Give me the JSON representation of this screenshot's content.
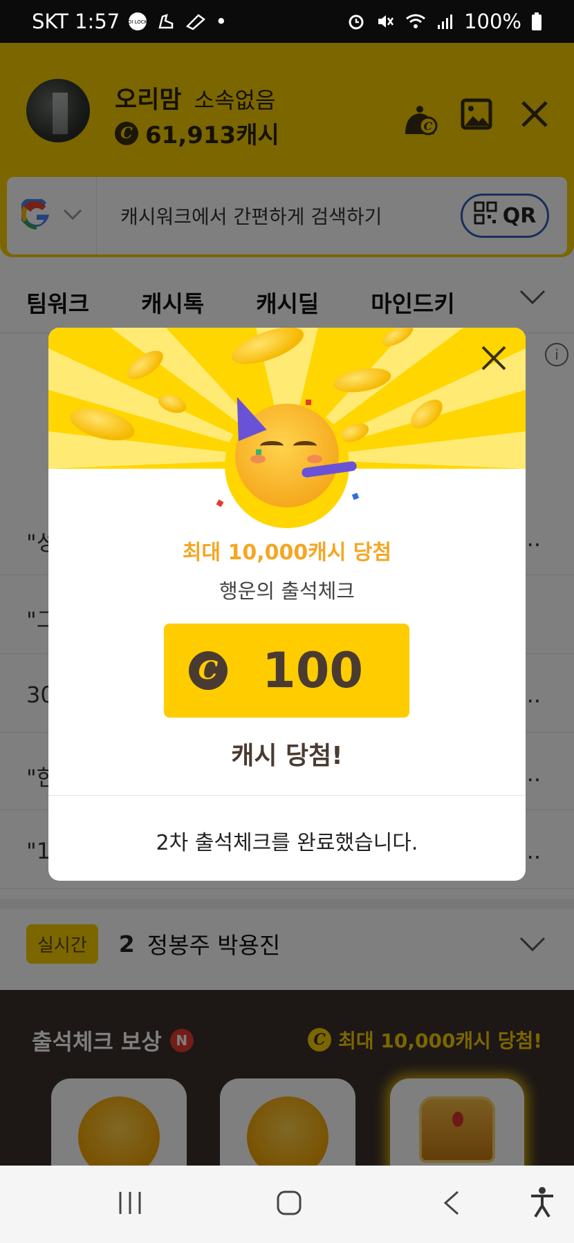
{
  "status_bar": {
    "carrier_time": "SKT 1:57",
    "lock_badge": "OI LOCK",
    "dot": "•",
    "battery": "100%"
  },
  "header": {
    "user_name": "오리맘",
    "user_org": "소속없음",
    "cash_amount": "61,913캐시",
    "coin_symbol": "C"
  },
  "search": {
    "placeholder": "캐시워크에서 간편하게 검색하기",
    "qr_label": "QR"
  },
  "tabs": [
    "팀워크",
    "캐시톡",
    "캐시딜",
    "마인드키"
  ],
  "background_list": [
    {
      "lead": "\"성",
      "trail": "..."
    },
    {
      "lead": "\"그",
      "trail": ""
    },
    {
      "lead": "30",
      "trail": "..."
    },
    {
      "lead": "\"한",
      "trail": "..."
    },
    {
      "lead": "\"1",
      "trail": "..."
    }
  ],
  "realtime": {
    "badge": "실시간",
    "rank": "2",
    "keyword": "정봉주 박용진"
  },
  "attendance": {
    "title": "출석체크 보상",
    "new_badge": "N",
    "max_reward": "최대 10,000캐시 당첨!"
  },
  "modal": {
    "max_text": "최대 10,000캐시 당첨",
    "subtitle": "행운의 출석체크",
    "amount": "100",
    "coin_symbol": "C",
    "won_text": "캐시 당첨!",
    "complete_text": "2차 출석체크를 완료했습니다."
  },
  "colors": {
    "brand_yellow": "#f7cc00",
    "modal_yellow": "#ffd600",
    "dark_brown": "#4a3b32",
    "orange_text": "#f5a623"
  }
}
